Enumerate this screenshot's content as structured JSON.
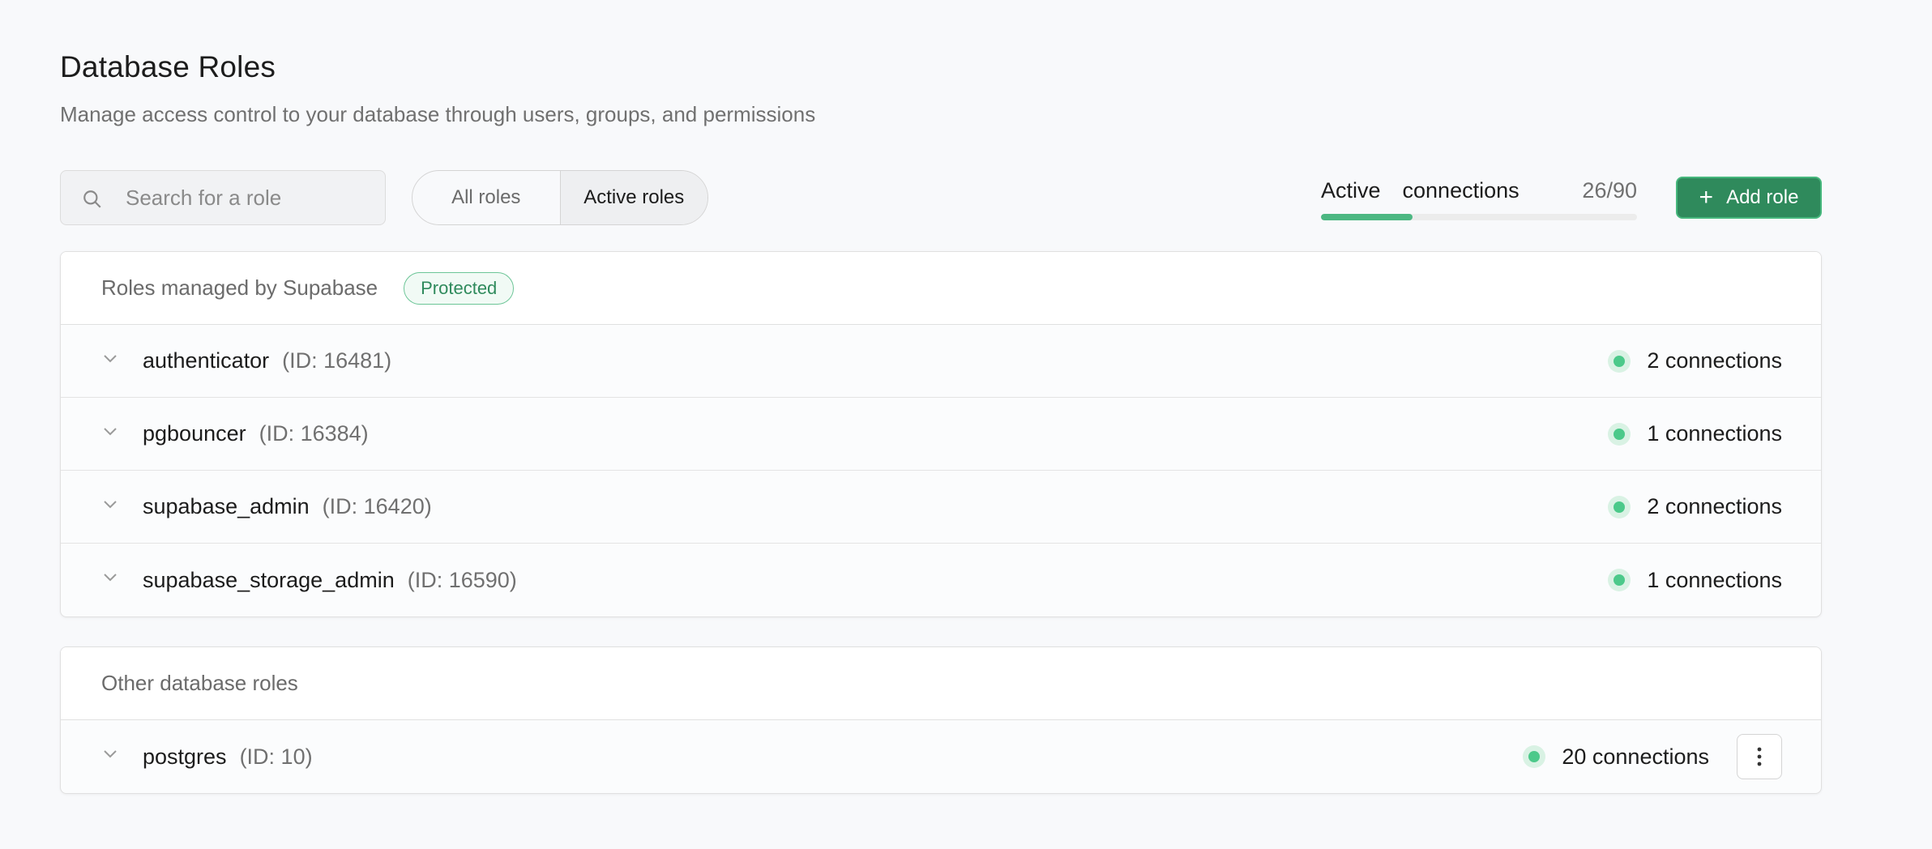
{
  "header": {
    "title": "Database Roles",
    "subtitle": "Manage access control to your database through users, groups, and permissions"
  },
  "search": {
    "placeholder": "Search for a role",
    "value": ""
  },
  "filter_tabs": [
    {
      "label": "All roles",
      "active": false
    },
    {
      "label": "Active roles",
      "active": true
    }
  ],
  "connections": {
    "label": "Active  connections",
    "count": "26/90",
    "used": 26,
    "max": 90
  },
  "add_role_button": {
    "label": "Add role",
    "icon": "plus-icon"
  },
  "managed_section": {
    "title": "Roles managed by Supabase",
    "badge": "Protected",
    "roles": [
      {
        "name": "authenticator",
        "id": "(ID: 16481)",
        "connections": "2 connections"
      },
      {
        "name": "pgbouncer",
        "id": "(ID: 16384)",
        "connections": "1 connections"
      },
      {
        "name": "supabase_admin",
        "id": "(ID: 16420)",
        "connections": "2 connections"
      },
      {
        "name": "supabase_storage_admin",
        "id": "(ID: 16590)",
        "connections": "1 connections"
      }
    ]
  },
  "other_section": {
    "title": "Other database roles",
    "roles": [
      {
        "name": "postgres",
        "id": "(ID: 10)",
        "connections": "20 connections"
      }
    ]
  },
  "colors": {
    "accent": "#2f8a5c",
    "status_dot": "#4cc98a",
    "progress_fill": "#4cb782"
  }
}
